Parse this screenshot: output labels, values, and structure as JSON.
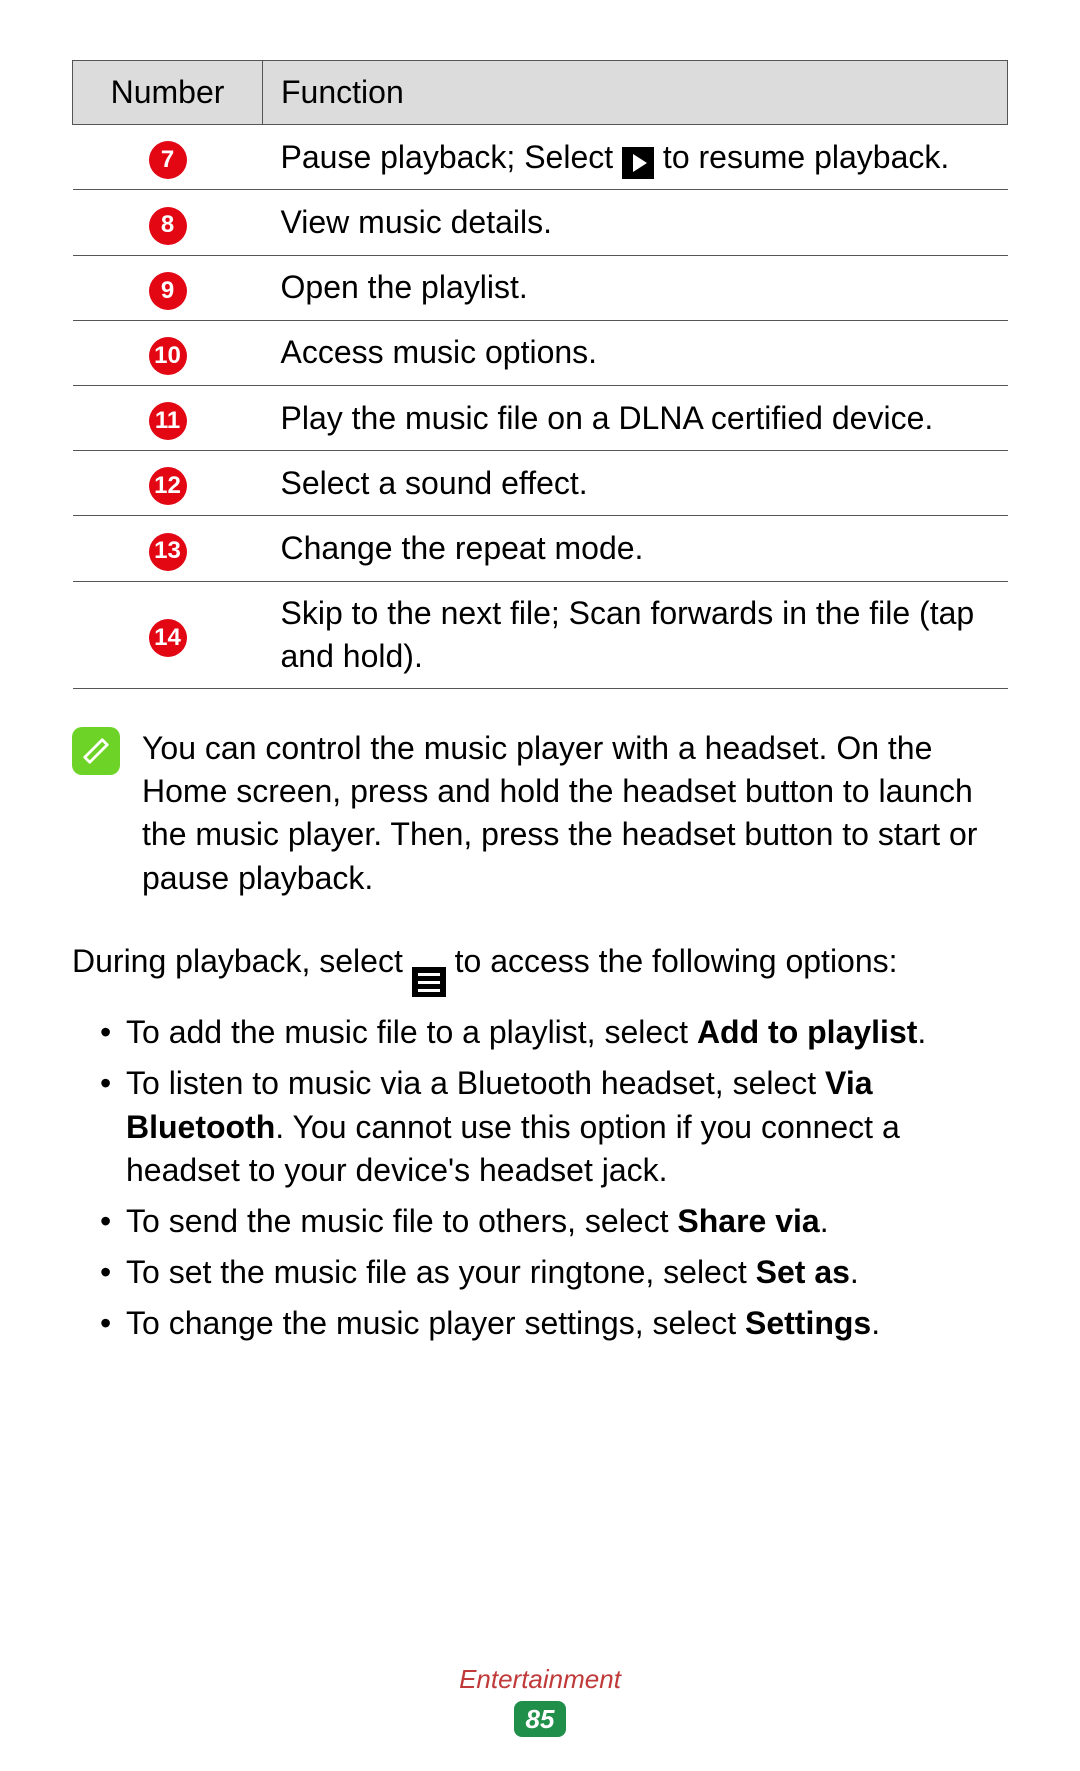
{
  "table": {
    "headers": {
      "number": "Number",
      "function": "Function"
    },
    "rows": [
      {
        "num": "7",
        "pre": "Pause playback; Select ",
        "post": " to resume playback.",
        "icon": "play"
      },
      {
        "num": "8",
        "text": "View music details."
      },
      {
        "num": "9",
        "text": "Open the playlist."
      },
      {
        "num": "10",
        "text": "Access music options."
      },
      {
        "num": "11",
        "text": "Play the music file on a DLNA certified device."
      },
      {
        "num": "12",
        "text": "Select a sound effect."
      },
      {
        "num": "13",
        "text": "Change the repeat mode."
      },
      {
        "num": "14",
        "text": "Skip to the next file; Scan forwards in the file (tap and hold)."
      }
    ]
  },
  "note": "You can control the music player with a headset. On the Home screen, press and hold the headset button to launch the music player. Then, press the headset button to start or pause playback.",
  "intro": {
    "pre": "During playback, select ",
    "post": " to access the following options:"
  },
  "options": [
    {
      "pre": "To add the music file to a playlist, select ",
      "bold": "Add to playlist",
      "post": "."
    },
    {
      "pre": "To listen to music via a Bluetooth headset, select ",
      "bold": "Via Bluetooth",
      "post": ". You cannot use this option if you connect a headset to your device's headset jack."
    },
    {
      "pre": "To send the music file to others, select ",
      "bold": "Share via",
      "post": "."
    },
    {
      "pre": "To set the music file as your ringtone, select ",
      "bold": "Set as",
      "post": "."
    },
    {
      "pre": "To change the music player settings, select ",
      "bold": "Settings",
      "post": "."
    }
  ],
  "footer": {
    "section": "Entertainment",
    "page": "85"
  }
}
